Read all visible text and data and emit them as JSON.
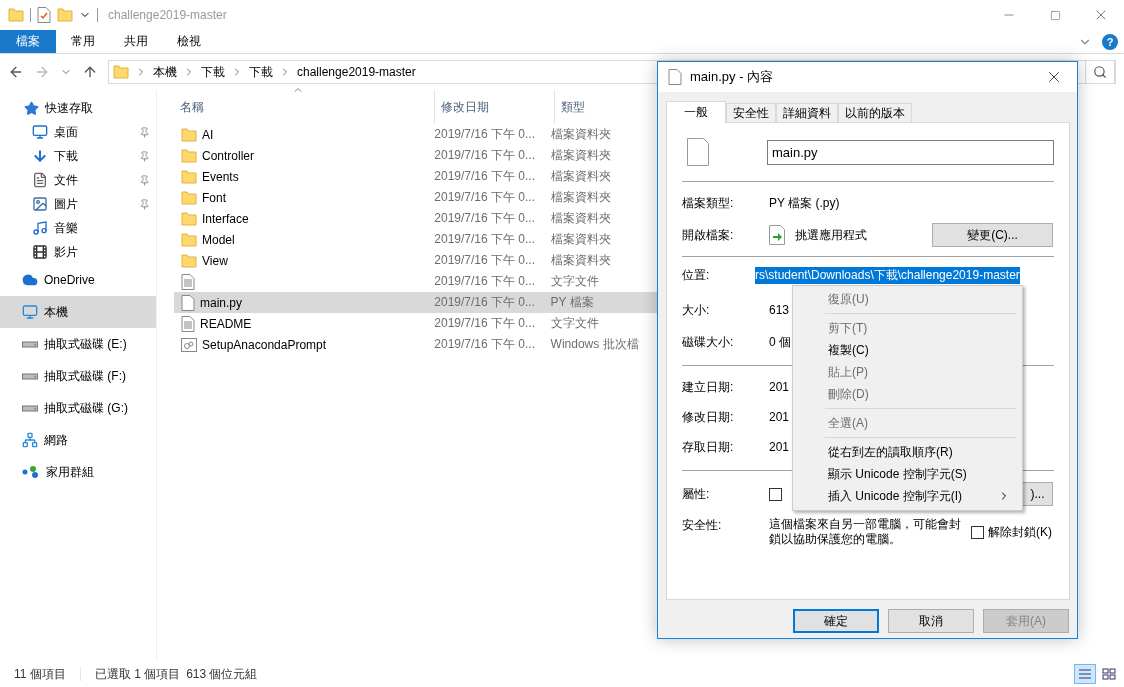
{
  "title_bar": {
    "title": "challenge2019-master"
  },
  "ribbon": {
    "tabs": [
      {
        "label": "檔案",
        "selected": true
      },
      {
        "label": "常用",
        "selected": false
      },
      {
        "label": "共用",
        "selected": false
      },
      {
        "label": "檢視",
        "selected": false
      }
    ],
    "help": "?"
  },
  "address_bar": {
    "segments": [
      "本機",
      "下載",
      "下載",
      "challenge2019-master"
    ]
  },
  "sidebar": {
    "items": [
      {
        "label": "快速存取",
        "kind": "star",
        "selected": false,
        "children": [
          {
            "label": "桌面",
            "kind": "desktop",
            "pinned": true,
            "selected": false
          },
          {
            "label": "下載",
            "kind": "download",
            "pinned": true,
            "selected": false
          },
          {
            "label": "文件",
            "kind": "document",
            "pinned": true,
            "selected": false
          },
          {
            "label": "圖片",
            "kind": "picture",
            "pinned": true,
            "selected": false
          },
          {
            "label": "音樂",
            "kind": "music",
            "pinned": false,
            "selected": false
          },
          {
            "label": "影片",
            "kind": "video",
            "pinned": false,
            "selected": false
          }
        ]
      },
      {
        "label": "OneDrive",
        "kind": "cloud",
        "selected": false
      },
      {
        "label": "本機",
        "kind": "computer",
        "selected": true
      },
      {
        "label": "抽取式磁碟 (E:)",
        "kind": "drive",
        "selected": false
      },
      {
        "label": "抽取式磁碟 (F:)",
        "kind": "drive",
        "selected": false
      },
      {
        "label": "抽取式磁碟 (G:)",
        "kind": "drive",
        "selected": false
      },
      {
        "label": "網路",
        "kind": "network",
        "selected": false
      },
      {
        "label": "家用群組",
        "kind": "homegroup",
        "selected": false
      }
    ]
  },
  "file_list": {
    "columns": [
      "名稱",
      "修改日期",
      "類型"
    ],
    "rows": [
      {
        "kind": "folder",
        "name": "AI",
        "date": "2019/7/16 下午 0...",
        "type": "檔案資料夾",
        "selected": false
      },
      {
        "kind": "folder",
        "name": "Controller",
        "date": "2019/7/16 下午 0...",
        "type": "檔案資料夾",
        "selected": false
      },
      {
        "kind": "folder",
        "name": "Events",
        "date": "2019/7/16 下午 0...",
        "type": "檔案資料夾",
        "selected": false
      },
      {
        "kind": "folder",
        "name": "Font",
        "date": "2019/7/16 下午 0...",
        "type": "檔案資料夾",
        "selected": false
      },
      {
        "kind": "folder",
        "name": "Interface",
        "date": "2019/7/16 下午 0...",
        "type": "檔案資料夾",
        "selected": false
      },
      {
        "kind": "folder",
        "name": "Model",
        "date": "2019/7/16 下午 0...",
        "type": "檔案資料夾",
        "selected": false
      },
      {
        "kind": "folder",
        "name": "View",
        "date": "2019/7/16 下午 0...",
        "type": "檔案資料夾",
        "selected": false
      },
      {
        "kind": "text",
        "date": "2019/7/16 下午 0...",
        "type": "文字文件",
        "selected": false
      },
      {
        "kind": "file",
        "name": "main.py",
        "date": "2019/7/16 下午 0...",
        "type": "PY 檔案",
        "selected": true
      },
      {
        "kind": "text",
        "name": "README",
        "date": "2019/7/16 下午 0...",
        "type": "文字文件",
        "selected": false
      },
      {
        "kind": "batch",
        "name": "SetupAnacondaPrompt",
        "date": "2019/7/16 下午 0...",
        "type": "Windows 批次檔",
        "selected": false
      }
    ]
  },
  "status_bar": {
    "count": "11 個項目",
    "selection": "已選取 1 個項目",
    "size": "613 個位元組",
    "views": [
      {
        "kind": "details",
        "selected": true
      },
      {
        "kind": "tiles",
        "selected": false
      }
    ]
  },
  "dialog": {
    "title": "main.py - 內容",
    "tabs": [
      {
        "label": "一般",
        "selected": true
      },
      {
        "label": "安全性",
        "selected": false
      },
      {
        "label": "詳細資料",
        "selected": false
      },
      {
        "label": "以前的版本",
        "selected": false
      }
    ],
    "file_name": "main.py",
    "file_type": {
      "label": "檔案類型:",
      "value": "PY 檔案 (.py)"
    },
    "open_with": {
      "label": "開啟檔案:",
      "app": "挑選應用程式",
      "button": "變更(C)..."
    },
    "location": {
      "label": "位置:",
      "value": "rs\\student\\Downloads\\下載\\challenge2019-master"
    },
    "size": {
      "label": "大小:",
      "value": "613"
    },
    "disk_size": {
      "label": "磁碟大小:",
      "value": "0 個"
    },
    "dates": [
      {
        "label": "建立日期:",
        "value": "201"
      },
      {
        "label": "修改日期:",
        "value": "201"
      },
      {
        "label": "存取日期:",
        "value": "201"
      }
    ],
    "attributes": {
      "label": "屬性:",
      "checked": false,
      "button": ")..."
    },
    "security": {
      "label": "安全性:",
      "text": "這個檔案來自另一部電腦，可能會封鎖以協助保護您的電腦。",
      "unblock": {
        "label": "解除封鎖(K)",
        "checked": false
      }
    },
    "buttons": [
      {
        "label": "確定",
        "kind": "default"
      },
      {
        "label": "取消",
        "kind": "normal"
      },
      {
        "label": "套用(A)",
        "kind": "disabled"
      }
    ]
  },
  "context_menu": {
    "items": [
      {
        "kind": "item",
        "label": "復原(U)",
        "disabled": true,
        "submenu": false
      },
      {
        "kind": "separator"
      },
      {
        "kind": "item",
        "label": "剪下(T)",
        "disabled": true,
        "submenu": false
      },
      {
        "kind": "item",
        "label": "複製(C)",
        "disabled": false,
        "submenu": false
      },
      {
        "kind": "item",
        "label": "貼上(P)",
        "disabled": true,
        "submenu": false
      },
      {
        "kind": "item",
        "label": "刪除(D)",
        "disabled": true,
        "submenu": false
      },
      {
        "kind": "separator"
      },
      {
        "kind": "item",
        "label": "全選(A)",
        "disabled": true,
        "submenu": false
      },
      {
        "kind": "separator"
      },
      {
        "kind": "item",
        "label": "從右到左的讀取順序(R)",
        "disabled": false,
        "submenu": false
      },
      {
        "kind": "item",
        "label": "顯示 Unicode 控制字元(S)",
        "disabled": false,
        "submenu": false
      },
      {
        "kind": "item",
        "label": "插入 Unicode 控制字元(I)",
        "disabled": false,
        "submenu": true
      }
    ]
  }
}
